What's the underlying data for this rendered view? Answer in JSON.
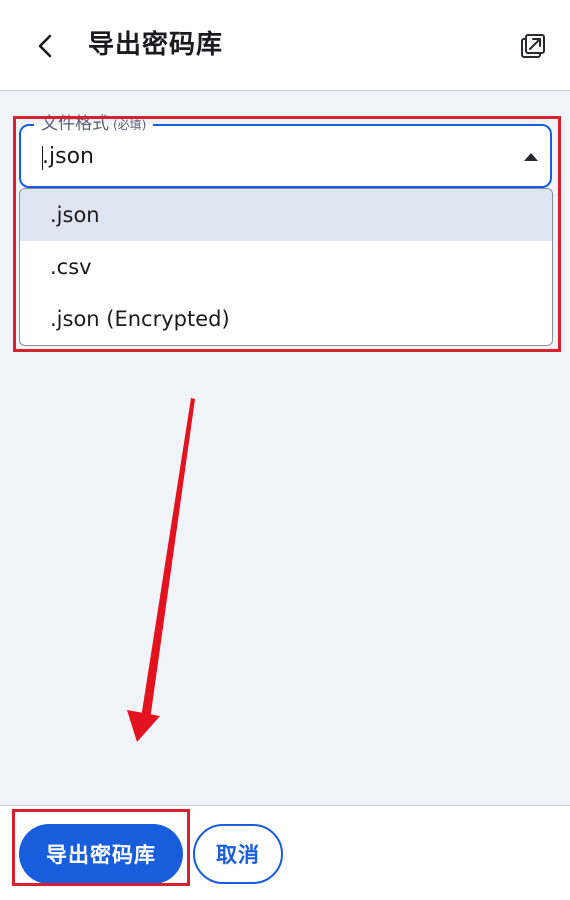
{
  "header": {
    "title": "导出密码库",
    "back_icon": "chevron-left-icon",
    "popout_icon": "popout-window-icon"
  },
  "form": {
    "file_format": {
      "label": "文件格式",
      "required_text": "(必填)",
      "value": ".json",
      "dropdown_icon": "triangle-up-icon",
      "options": [
        {
          "label": ".json",
          "selected": true
        },
        {
          "label": ".csv",
          "selected": false
        },
        {
          "label": ".json (Encrypted)",
          "selected": false
        }
      ]
    }
  },
  "footer": {
    "export_button": "导出密码库",
    "cancel_button": "取消"
  },
  "colors": {
    "accent": "#175ddc",
    "annotation": "#d9202f",
    "background": "#f0f4f9",
    "selected_option": "#dde5f0"
  }
}
